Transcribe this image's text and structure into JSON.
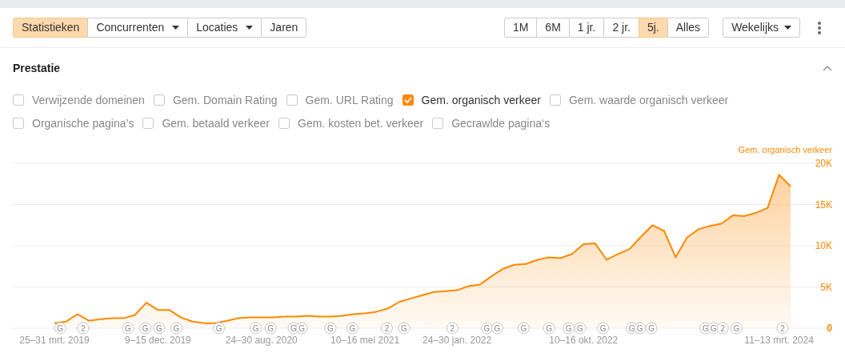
{
  "view_tabs": [
    {
      "label": "Statistieken",
      "selected": true,
      "dropdown": false
    },
    {
      "label": "Concurrenten",
      "selected": false,
      "dropdown": true
    },
    {
      "label": "Locaties",
      "selected": false,
      "dropdown": true
    },
    {
      "label": "Jaren",
      "selected": false,
      "dropdown": false
    }
  ],
  "ranges": [
    {
      "label": "1M",
      "selected": false
    },
    {
      "label": "6M",
      "selected": false
    },
    {
      "label": "1 jr.",
      "selected": false
    },
    {
      "label": "2 jr.",
      "selected": false
    },
    {
      "label": "5j.",
      "selected": true
    },
    {
      "label": "Alles",
      "selected": false
    }
  ],
  "interval": {
    "label": "Wekelijks"
  },
  "section": {
    "title": "Prestatie",
    "expanded": true,
    "metrics": [
      {
        "label": "Verwijzende domeinen",
        "checked": false
      },
      {
        "label": "Gem. Domain Rating",
        "checked": false
      },
      {
        "label": "Gem. URL Rating",
        "checked": false
      },
      {
        "label": "Gem. organisch verkeer",
        "checked": true
      },
      {
        "label": "Gem. waarde organisch verkeer",
        "checked": false
      },
      {
        "label": "Organische pagina’s",
        "checked": false
      },
      {
        "label": "Gem. betaald verkeer",
        "checked": false
      },
      {
        "label": "Gem. kosten bet. verkeer",
        "checked": false
      },
      {
        "label": "Gecrawlde pagina‘s",
        "checked": false
      }
    ],
    "chart_data": {
      "type": "area",
      "categories": [
        "25–31 mrt. 2019",
        null,
        null,
        null,
        null,
        null,
        null,
        null,
        null,
        "9–15 dec. 2019",
        null,
        null,
        null,
        null,
        null,
        null,
        null,
        null,
        "24–30 aug. 2020",
        null,
        null,
        null,
        null,
        null,
        null,
        null,
        null,
        "10–16 mei 2021",
        null,
        null,
        null,
        null,
        null,
        null,
        null,
        "24–30 jan. 2022",
        null,
        null,
        null,
        null,
        null,
        null,
        null,
        null,
        null,
        null,
        "10–16 okt. 2022",
        null,
        null,
        null,
        null,
        null,
        null,
        null,
        null,
        null,
        null,
        null,
        null,
        null,
        null,
        null,
        null,
        "11–13 mrt. 2024",
        null
      ],
      "series": [
        {
          "name": "Gem. organisch verkeer",
          "color": "#ff8800",
          "values": [
            600,
            800,
            1700,
            900,
            1100,
            1200,
            1200,
            1600,
            3100,
            2200,
            2200,
            1300,
            800,
            600,
            600,
            900,
            1200,
            1300,
            1300,
            1300,
            1400,
            1400,
            1500,
            1400,
            1400,
            1500,
            1700,
            1800,
            2000,
            2400,
            3200,
            3600,
            4000,
            4400,
            4500,
            4600,
            5100,
            5300,
            6300,
            7200,
            7700,
            7800,
            8300,
            8600,
            8500,
            9000,
            10200,
            10300,
            8300,
            9000,
            9600,
            11100,
            12500,
            11800,
            8600,
            11000,
            12000,
            12400,
            12700,
            13700,
            13600,
            14000,
            14600,
            18600,
            17200
          ]
        }
      ],
      "ylim": [
        0,
        20000
      ],
      "yticks": [
        {
          "value": 0,
          "label": "0"
        },
        {
          "value": 5000,
          "label": "5K"
        },
        {
          "value": 10000,
          "label": "10K"
        },
        {
          "value": 15000,
          "label": "15K"
        },
        {
          "value": 20000,
          "label": "20K"
        }
      ],
      "grid": true
    },
    "event_markers": [
      "G",
      "2",
      "G",
      "G",
      "G",
      "G",
      "G",
      "G",
      "G",
      "G",
      "G",
      "G",
      "G",
      "2",
      "G",
      "2",
      "G",
      "G",
      "G",
      "G",
      "G",
      "G",
      "G",
      "G",
      "G",
      "G",
      "G",
      "G",
      "2",
      "G",
      "2"
    ]
  }
}
